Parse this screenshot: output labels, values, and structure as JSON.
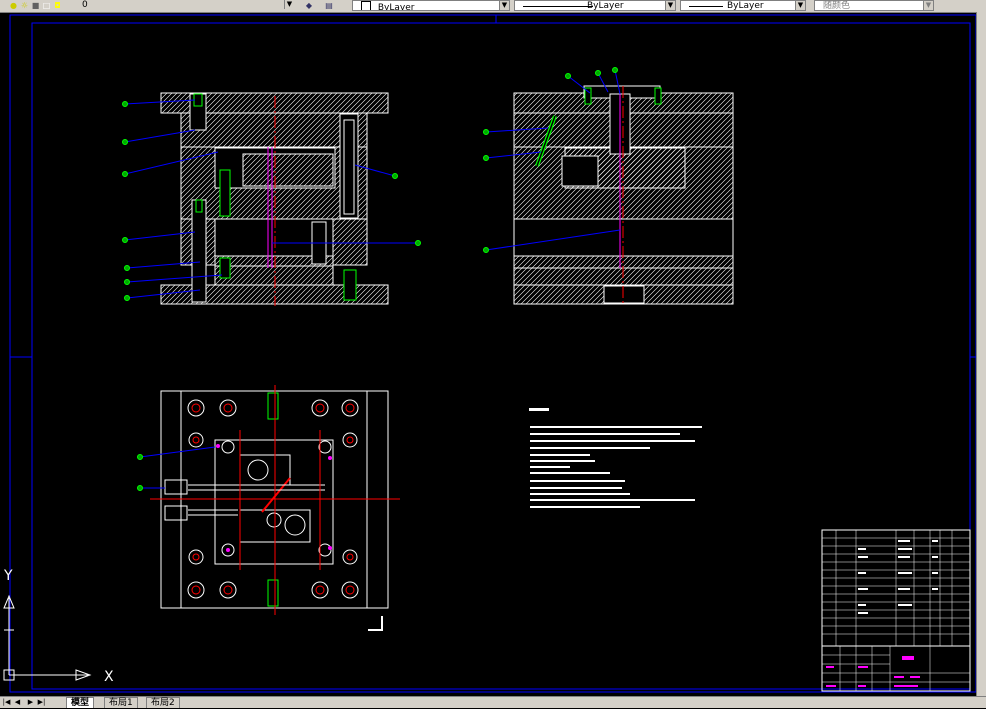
{
  "toolbar": {
    "layer_value": "0",
    "color_value": "ByLayer",
    "linetype_value": "ByLayer",
    "lineweight_value": "ByLayer",
    "plotstyle_value": "随颜色"
  },
  "ucs": {
    "x_label": "X",
    "y_label": "Y"
  },
  "tabs": [
    {
      "label": "模型"
    },
    {
      "label": "布局1"
    },
    {
      "label": "布局2"
    }
  ],
  "colors": {
    "background": "#000000",
    "border": "#0000ff",
    "hatch": "#ffffff",
    "centerline": "#ff0000",
    "leader": "#0000ff",
    "balloon": "#00ff00",
    "highlight": "#ff00ff"
  },
  "icons": [
    "layer-lightbulb-icon",
    "layer-sun-icon",
    "layer-lock-icon",
    "layer-color-icon",
    "layer-prev-icon",
    "layer-stack-icon",
    "ucs-icon"
  ]
}
